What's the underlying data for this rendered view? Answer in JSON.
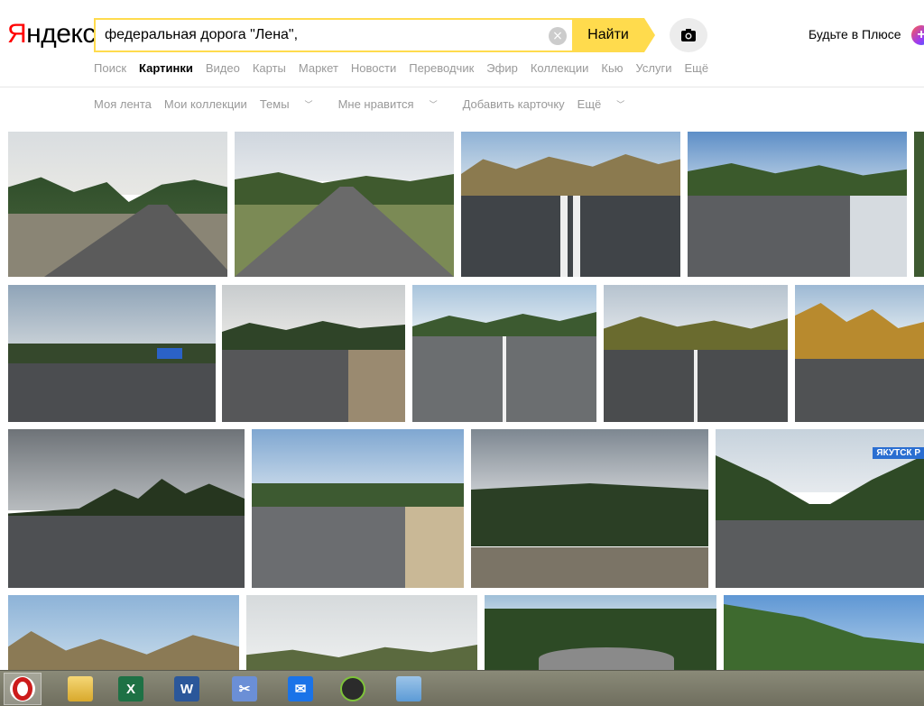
{
  "logo": {
    "first": "Я",
    "rest": "ндекс"
  },
  "search": {
    "value": "федеральная дорога \"Лена\",",
    "clear_glyph": "×",
    "button": "Найти"
  },
  "plus": {
    "text": "Будьте в Плюсе",
    "badge": "+"
  },
  "nav": [
    {
      "label": "Поиск",
      "active": false
    },
    {
      "label": "Картинки",
      "active": true
    },
    {
      "label": "Видео",
      "active": false
    },
    {
      "label": "Карты",
      "active": false
    },
    {
      "label": "Маркет",
      "active": false
    },
    {
      "label": "Новости",
      "active": false
    },
    {
      "label": "Переводчик",
      "active": false
    },
    {
      "label": "Эфир",
      "active": false
    },
    {
      "label": "Коллекции",
      "active": false
    },
    {
      "label": "Кью",
      "active": false
    },
    {
      "label": "Услуги",
      "active": false
    },
    {
      "label": "Ещё",
      "active": false
    }
  ],
  "subnav": [
    {
      "label": "Моя лента",
      "dropdown": false
    },
    {
      "label": "Мои коллекции",
      "dropdown": false
    },
    {
      "label": "Темы",
      "dropdown": true
    },
    {
      "label": "Мне нравится",
      "dropdown": true
    },
    {
      "label": "Добавить карточку",
      "dropdown": false
    },
    {
      "label": "Ещё",
      "dropdown": true
    }
  ],
  "image_badges": {
    "yakutsk": "ЯКУТСК Р"
  },
  "taskbar": [
    {
      "name": "opera",
      "label": "O",
      "color": "#cc1b1b"
    },
    {
      "name": "file-explorer",
      "label": "",
      "color": "#e8c14a"
    },
    {
      "name": "excel",
      "label": "X",
      "color": "#1e7145"
    },
    {
      "name": "word",
      "label": "W",
      "color": "#2b579a"
    },
    {
      "name": "snipping-tool",
      "label": "✂",
      "color": "#6b8fd6"
    },
    {
      "name": "mail",
      "label": "✉",
      "color": "#1a73e8"
    },
    {
      "name": "xbox",
      "label": "",
      "color": "#2b2b2b"
    },
    {
      "name": "calculator",
      "label": "",
      "color": "#5c9bd6"
    }
  ]
}
